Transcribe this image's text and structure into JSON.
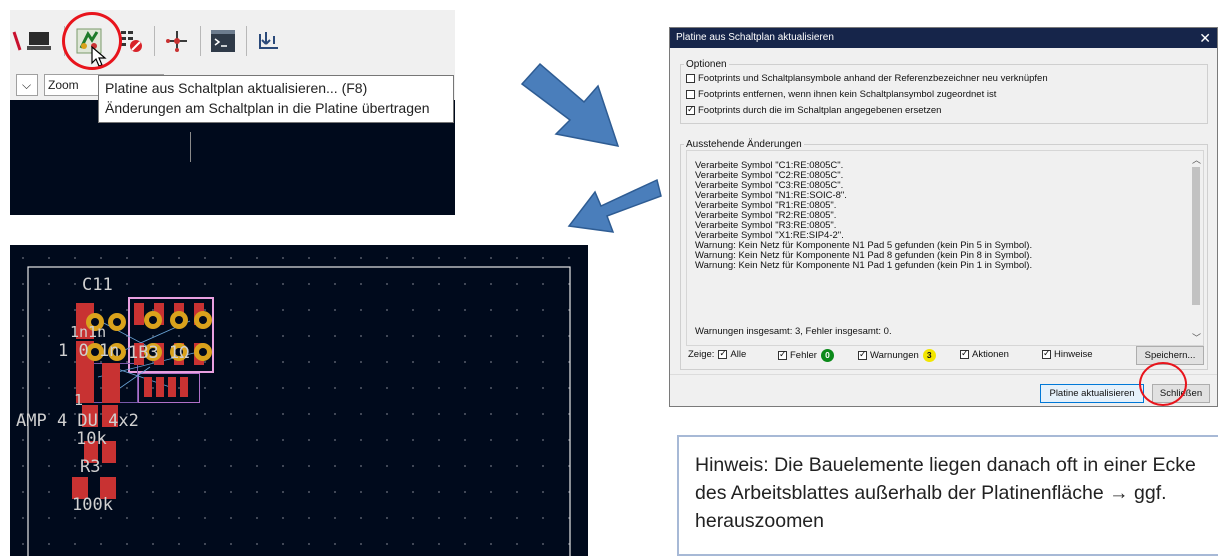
{
  "tooltip": {
    "line1": "Platine aus Schaltplan aktualisieren... (F8)",
    "line2": "Änderungen am Schaltplan in die Platine übertragen"
  },
  "toolbar": {
    "zoom_combo": "Zoom"
  },
  "dialog": {
    "title": "Platine aus Schaltplan aktualisieren",
    "close_glyph": "✕",
    "options_label": "Optionen",
    "options": [
      {
        "label": "Footprints und Schaltplansymbole anhand der Referenzbezeichner neu verknüpfen",
        "checked": false
      },
      {
        "label": "Footprints entfernen, wenn ihnen kein Schaltplansymbol zugeordnet ist",
        "checked": false
      },
      {
        "label": "Footprints durch die im Schaltplan angegebenen ersetzen",
        "checked": true
      }
    ],
    "changes_label": "Ausstehende Änderungen",
    "changes": [
      "Verarbeite Symbol \"C1:RE:0805C\".",
      "Verarbeite Symbol \"C2:RE:0805C\".",
      "Verarbeite Symbol \"C3:RE:0805C\".",
      "Verarbeite Symbol \"N1:RE:SOIC-8\".",
      "Verarbeite Symbol \"R1:RE:0805\".",
      "Verarbeite Symbol \"R2:RE:0805\".",
      "Verarbeite Symbol \"R3:RE:0805\".",
      "Verarbeite Symbol \"X1:RE:SIP4-2\".",
      "Warnung: Kein Netz für Komponente N1 Pad 5 gefunden (kein Pin 5 in Symbol).",
      "Warnung: Kein Netz für Komponente N1 Pad 8 gefunden (kein Pin 8 in Symbol).",
      "Warnung: Kein Netz für Komponente N1 Pad 1 gefunden (kein Pin 1 in Symbol)."
    ],
    "summary": "Warnungen insgesamt: 3, Fehler insgesamt: 0.",
    "show_label": "Zeige:",
    "filters": {
      "all": "Alle",
      "errors": "Fehler",
      "errors_count": "0",
      "warnings": "Warnungen",
      "warnings_count": "3",
      "actions": "Aktionen",
      "hints": "Hinweise"
    },
    "save_button": "Speichern...",
    "update_button": "Platine aktualisieren",
    "close_button": "Schließen"
  },
  "pcb": {
    "labels": {
      "c1": "C11",
      "n1_value": "1 0 1n",
      "n1_ref": "1",
      "u1_value": "1B3 1Ω",
      "c2_value": "1n1n",
      "amp_label": "AMP 4 DU 4x2",
      "r_value": "10k",
      "r3": "R3",
      "r_bottom": "100k"
    }
  },
  "note": {
    "text": "Hinweis: Die Bauelemente liegen danach oft in einer Ecke des Arbeitsblattes außerhalb der Platinenfläche → ggf. herauszoomen"
  },
  "colors": {
    "arrow_fill": "#4a7ebb",
    "highlight_circle": "#e8141c",
    "pcb_background": "#000a1c",
    "pad_red": "#c83232",
    "tht_gold": "#d9a21c",
    "dialog_title_bar": "#16254a",
    "badge_green": "#0b8a1a",
    "badge_yellow": "#f2e600"
  }
}
